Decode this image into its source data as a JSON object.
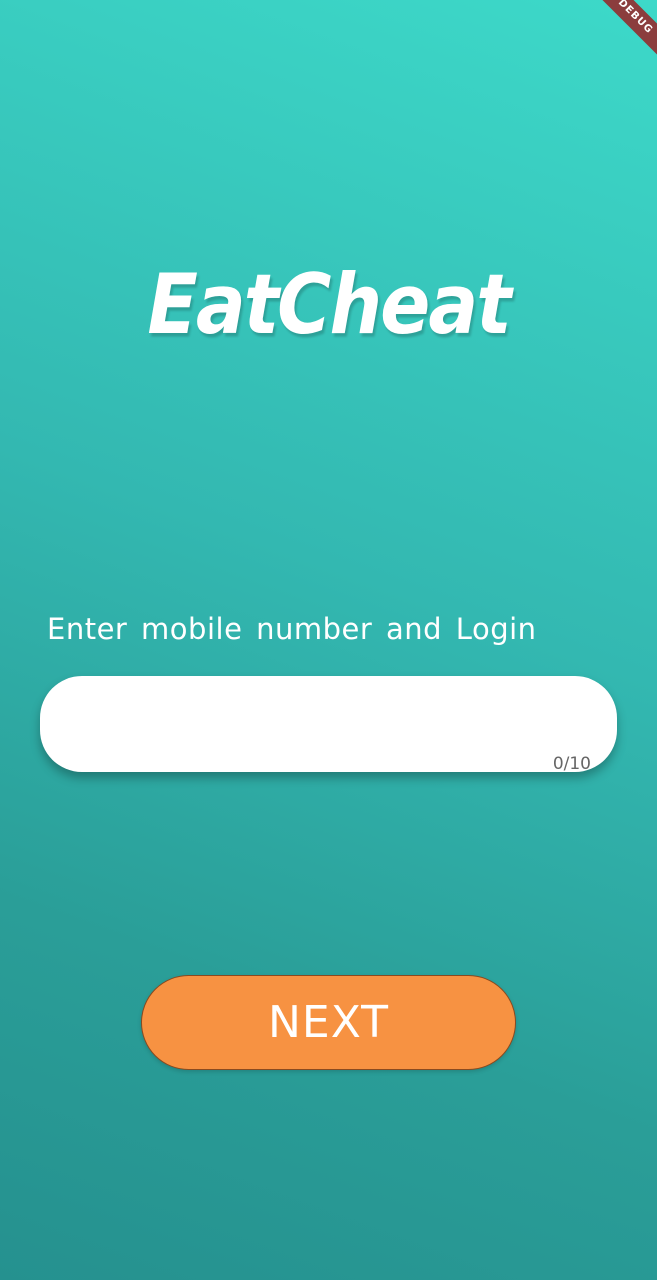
{
  "debug_banner": {
    "label": "DEBUG",
    "color": "#8b3d3d"
  },
  "logo": {
    "text": "EatCheat"
  },
  "login": {
    "prompt": "Enter mobile number and Login",
    "phone_input": {
      "value": "",
      "placeholder": ""
    },
    "char_counter": "0/10"
  },
  "next_button": {
    "label": "NEXT",
    "color": "#f79242"
  },
  "background": {
    "gradient_top": "#3dd9c9",
    "gradient_bottom": "#25918f"
  }
}
